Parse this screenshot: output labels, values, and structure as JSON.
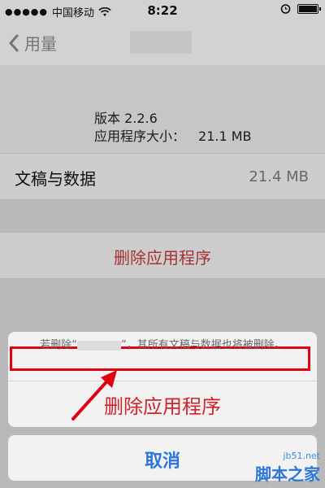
{
  "status": {
    "carrier": "中国移动",
    "time": "8:22"
  },
  "nav": {
    "back_label": "用量"
  },
  "info": {
    "version": "版本 2.2.6",
    "size_label": "应用程序大小：",
    "size_value": "21.1 MB"
  },
  "docs": {
    "label": "文稿与数据",
    "value": "21.4 MB"
  },
  "delete_cell": {
    "label": "删除应用程序"
  },
  "sheet": {
    "message_prefix": "若删除“",
    "message_suffix": "”，其所有文稿与数据也将被删除。",
    "delete_action": "删除应用程序"
  },
  "cancel": {
    "label": "取消"
  },
  "watermark": {
    "url": "jb51.net",
    "name": "脚本之家"
  },
  "colors": {
    "highlight": "#e1000f",
    "destructive": "#d0232a",
    "cancel": "#2b76d6"
  }
}
